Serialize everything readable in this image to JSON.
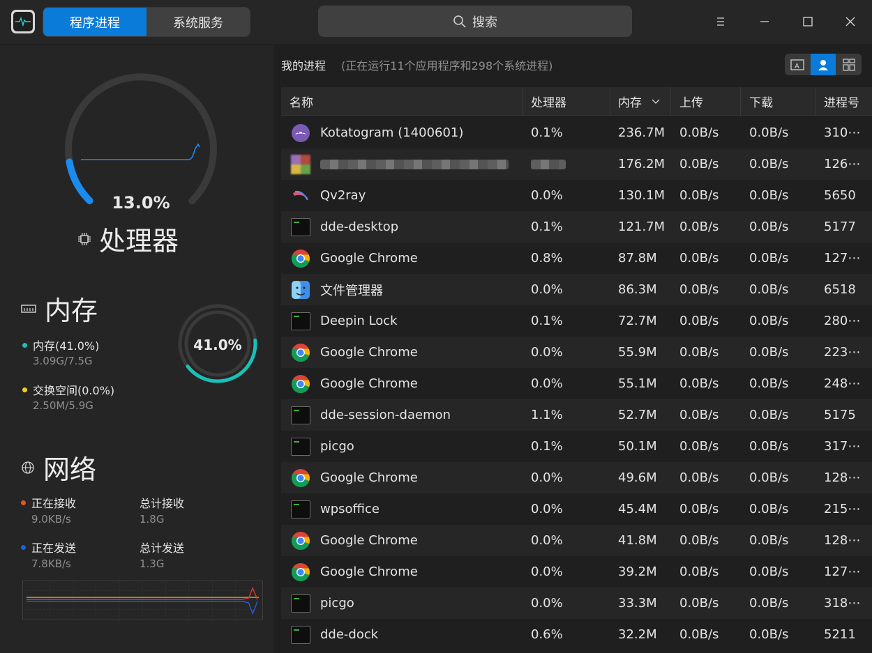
{
  "titlebar": {
    "tabs": [
      {
        "label": "程序进程",
        "active": true
      },
      {
        "label": "系统服务",
        "active": false
      }
    ],
    "search_label": "搜索"
  },
  "cpu": {
    "percent_label": "13.0%",
    "percent": 13.0,
    "title": "处理器"
  },
  "memory": {
    "title": "内存",
    "used_label": "内存(41.0%)",
    "used_value": "3.09G/7.5G",
    "swap_label": "交换空间(0.0%)",
    "swap_value": "2.50M/5.9G",
    "ring_label": "41.0%",
    "percent": 41.0
  },
  "network": {
    "title": "网络",
    "receiving_label": "正在接收",
    "receiving_value": "9.0KB/s",
    "total_recv_label": "总计接收",
    "total_recv_value": "1.8G",
    "sending_label": "正在发送",
    "sending_value": "7.8KB/s",
    "total_sent_label": "总计发送",
    "total_sent_value": "1.3G"
  },
  "processes": {
    "title": "我的进程",
    "summary": "(正在运行11个应用程序和298个系统进程)",
    "columns": [
      "名称",
      "处理器",
      "内存",
      "上传",
      "下载",
      "进程号"
    ],
    "rows": [
      {
        "name": "Kotatogram (1400601)",
        "icon": "kotatogram-icon",
        "cpu": "0.1%",
        "mem": "236.7M",
        "up": "0.0B/s",
        "down": "0.0B/s",
        "pid": "310⋯"
      },
      {
        "name": "",
        "icon": "blurred-app-icon",
        "cpu": "",
        "mem": "176.2M",
        "up": "0.0B/s",
        "down": "0.0B/s",
        "pid": "126⋯"
      },
      {
        "name": "Qv2ray",
        "icon": "qv2ray-icon",
        "cpu": "0.0%",
        "mem": "130.1M",
        "up": "0.0B/s",
        "down": "0.0B/s",
        "pid": "5650"
      },
      {
        "name": "dde-desktop",
        "icon": "terminal-icon",
        "cpu": "0.1%",
        "mem": "121.7M",
        "up": "0.0B/s",
        "down": "0.0B/s",
        "pid": "5177"
      },
      {
        "name": "Google Chrome",
        "icon": "chrome-icon",
        "cpu": "0.8%",
        "mem": "87.8M",
        "up": "0.0B/s",
        "down": "0.0B/s",
        "pid": "127⋯"
      },
      {
        "name": "文件管理器",
        "icon": "file-manager-icon",
        "cpu": "0.0%",
        "mem": "86.3M",
        "up": "0.0B/s",
        "down": "0.0B/s",
        "pid": "6518"
      },
      {
        "name": "Deepin Lock",
        "icon": "terminal-icon",
        "cpu": "0.1%",
        "mem": "72.7M",
        "up": "0.0B/s",
        "down": "0.0B/s",
        "pid": "280⋯"
      },
      {
        "name": "Google Chrome",
        "icon": "chrome-icon",
        "cpu": "0.0%",
        "mem": "55.9M",
        "up": "0.0B/s",
        "down": "0.0B/s",
        "pid": "223⋯"
      },
      {
        "name": "Google Chrome",
        "icon": "chrome-icon",
        "cpu": "0.0%",
        "mem": "55.1M",
        "up": "0.0B/s",
        "down": "0.0B/s",
        "pid": "248⋯"
      },
      {
        "name": "dde-session-daemon",
        "icon": "terminal-icon",
        "cpu": "1.1%",
        "mem": "52.7M",
        "up": "0.0B/s",
        "down": "0.0B/s",
        "pid": "5175"
      },
      {
        "name": "picgo",
        "icon": "terminal-icon",
        "cpu": "0.1%",
        "mem": "50.1M",
        "up": "0.0B/s",
        "down": "0.0B/s",
        "pid": "317⋯"
      },
      {
        "name": "Google Chrome",
        "icon": "chrome-icon",
        "cpu": "0.0%",
        "mem": "49.6M",
        "up": "0.0B/s",
        "down": "0.0B/s",
        "pid": "128⋯"
      },
      {
        "name": "wpsoffice",
        "icon": "terminal-icon",
        "cpu": "0.0%",
        "mem": "45.4M",
        "up": "0.0B/s",
        "down": "0.0B/s",
        "pid": "215⋯"
      },
      {
        "name": "Google Chrome",
        "icon": "chrome-icon",
        "cpu": "0.0%",
        "mem": "41.8M",
        "up": "0.0B/s",
        "down": "0.0B/s",
        "pid": "128⋯"
      },
      {
        "name": "Google Chrome",
        "icon": "chrome-icon",
        "cpu": "0.0%",
        "mem": "39.2M",
        "up": "0.0B/s",
        "down": "0.0B/s",
        "pid": "127⋯"
      },
      {
        "name": "picgo",
        "icon": "terminal-icon",
        "cpu": "0.0%",
        "mem": "33.3M",
        "up": "0.0B/s",
        "down": "0.0B/s",
        "pid": "318⋯"
      },
      {
        "name": "dde-dock",
        "icon": "terminal-icon",
        "cpu": "0.6%",
        "mem": "32.2M",
        "up": "0.0B/s",
        "down": "0.0B/s",
        "pid": "5211"
      }
    ]
  },
  "colors": {
    "accent": "#0a7bd9",
    "mem_ring": "#17c1b7",
    "swap_dot": "#e8d21d",
    "recv_dot": "#e8541d",
    "send_dot": "#1d5ee8"
  }
}
